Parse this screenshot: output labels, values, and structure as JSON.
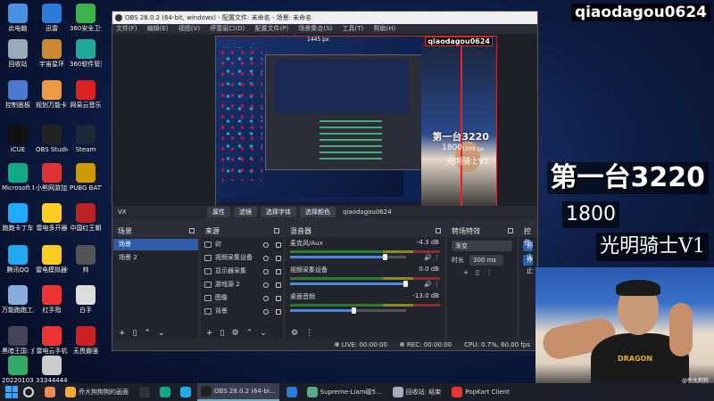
{
  "desktop_icons": [
    {
      "label": "此电脑",
      "color": "#4a90e2"
    },
    {
      "label": "迅雷",
      "color": "#2d7bd8"
    },
    {
      "label": "360安全卫士",
      "color": "#3bb34a"
    },
    {
      "label": "回收站",
      "color": "#9ab"
    },
    {
      "label": "宇宙星环",
      "color": "#c83"
    },
    {
      "label": "360软件管家",
      "color": "#2a9"
    },
    {
      "label": "控制面板",
      "color": "#4a7ad0"
    },
    {
      "label": "规划万能卡丁车助手",
      "color": "#e94"
    },
    {
      "label": "网易云音乐",
      "color": "#d22"
    },
    {
      "label": "iCUE",
      "color": "#111"
    },
    {
      "label": "OBS Studio",
      "color": "#222"
    },
    {
      "label": "Steam",
      "color": "#1b2838"
    },
    {
      "label": "Microsoft Edge",
      "color": "#1a8"
    },
    {
      "label": "小熊网游加速",
      "color": "#d33"
    },
    {
      "label": "PUBG BATTLEGR...",
      "color": "#c90"
    },
    {
      "label": "跑跑卡丁车",
      "color": "#2af"
    },
    {
      "label": "雷电多开器",
      "color": "#fc2"
    },
    {
      "label": "中国红王朝",
      "color": "#b22"
    },
    {
      "label": "腾讯QQ",
      "color": "#2ae"
    },
    {
      "label": "雷电模拟器9",
      "color": "#fc2"
    },
    {
      "label": "帅",
      "color": "#555"
    },
    {
      "label": "万能跑跑工具 EasyActiva...",
      "color": "#8ad"
    },
    {
      "label": "红手指",
      "color": "#e33"
    },
    {
      "label": "白手",
      "color": "#ddd"
    },
    {
      "label": "黑暗王国: 女王崛起",
      "color": "#445"
    },
    {
      "label": "雷电云手机",
      "color": "#e33"
    },
    {
      "label": "无畏霸强",
      "color": "#c22"
    },
    {
      "label": "20220103...",
      "color": "#3a6"
    },
    {
      "label": "333444444...",
      "color": "#ccc"
    }
  ],
  "obs": {
    "title": "OBS 28.0.2 (64-bit, windows) - 配置文件: 未命名 - 场景: 未命名",
    "menu": [
      "文件(F)",
      "编辑(E)",
      "视图(V)",
      "停靠窗口(D)",
      "配置文件(P)",
      "场景集合(S)",
      "工具(T)",
      "帮助(H)"
    ],
    "preview": {
      "width_text": "1445 px",
      "height_text": "1009 px",
      "handle": "qiaodagou0624",
      "line1": "第一台3220",
      "line2": "1800",
      "line3": "光明骑士V1"
    },
    "source_bar": {
      "selected": "VX",
      "buttons": [
        "属性",
        "滤镜",
        "选择字体",
        "选择颜色"
      ],
      "text": "qiaodagou0624"
    },
    "scenes": {
      "title": "场景",
      "items": [
        "场景",
        "场景 2"
      ],
      "active_index": 0
    },
    "sources": {
      "title": "来源",
      "items": [
        "卯",
        "视频采集设备",
        "显示器采集",
        "游戏源 2",
        "图像",
        "背景"
      ]
    },
    "mixer": {
      "title": "混音器",
      "channels": [
        {
          "name": "麦克风/Aux",
          "db": "-4.3 dB",
          "level": 0.82
        },
        {
          "name": "视频采集设备",
          "db": "0.0 dB",
          "level": 1.0
        },
        {
          "name": "桌面音频",
          "db": "-13.0 dB",
          "level": 0.55
        }
      ]
    },
    "transitions": {
      "title": "转场特效",
      "selected": "渐变",
      "duration_label": "时长",
      "duration": "300 ms"
    },
    "controls": {
      "title": "控件",
      "buttons": [
        "停止",
        "停止"
      ]
    },
    "status": {
      "live": "LIVE: 00:00:00",
      "rec": "REC: 00:00:00",
      "cpu": "CPU: 0.7%, 60.00 fps"
    }
  },
  "overlay": {
    "handle": "qiaodagou0624",
    "line1": "第一台3220",
    "line2": "1800",
    "line3": "光明骑士V1",
    "watermark": "@乔大狗狗",
    "shirt_text": "DRAGON"
  },
  "taskbar": {
    "items": [
      {
        "label": "",
        "color": "#e85"
      },
      {
        "label": "乔大狗狗狗的画面",
        "color": "#fa3"
      },
      {
        "label": "",
        "color": "#333"
      },
      {
        "label": "",
        "color": "#1a8"
      },
      {
        "label": "",
        "color": "#2ae"
      },
      {
        "label": "OBS 28.0.2 (64-bi...",
        "color": "#222",
        "active": true
      },
      {
        "label": "",
        "color": "#2d7bd8"
      },
      {
        "label": "Supreme-Liam碰5...",
        "color": "#5a8"
      },
      {
        "label": "回收站: 结束",
        "color": "#aab"
      },
      {
        "label": "PopKart Client",
        "color": "#e33"
      }
    ]
  },
  "colors": {
    "accent": "#2f5ea8",
    "live_red": "#e22"
  }
}
